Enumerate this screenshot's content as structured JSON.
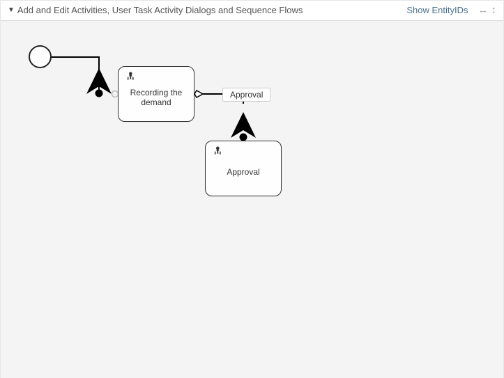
{
  "header": {
    "title": "Add and Edit Activities, User Task Activity Dialogs and Sequence Flows",
    "show_entity_ids_label": "Show EntityIDs"
  },
  "start_event": {
    "type": "start"
  },
  "activities": [
    {
      "name": "Recording the demand",
      "type": "user-task"
    },
    {
      "name": "Approval",
      "type": "user-task"
    }
  ],
  "flows": [
    {
      "from": "start",
      "to": "Recording the demand",
      "label": null
    },
    {
      "from": "Recording the demand",
      "to": "Approval",
      "label": "Approval",
      "conditional": true
    }
  ]
}
